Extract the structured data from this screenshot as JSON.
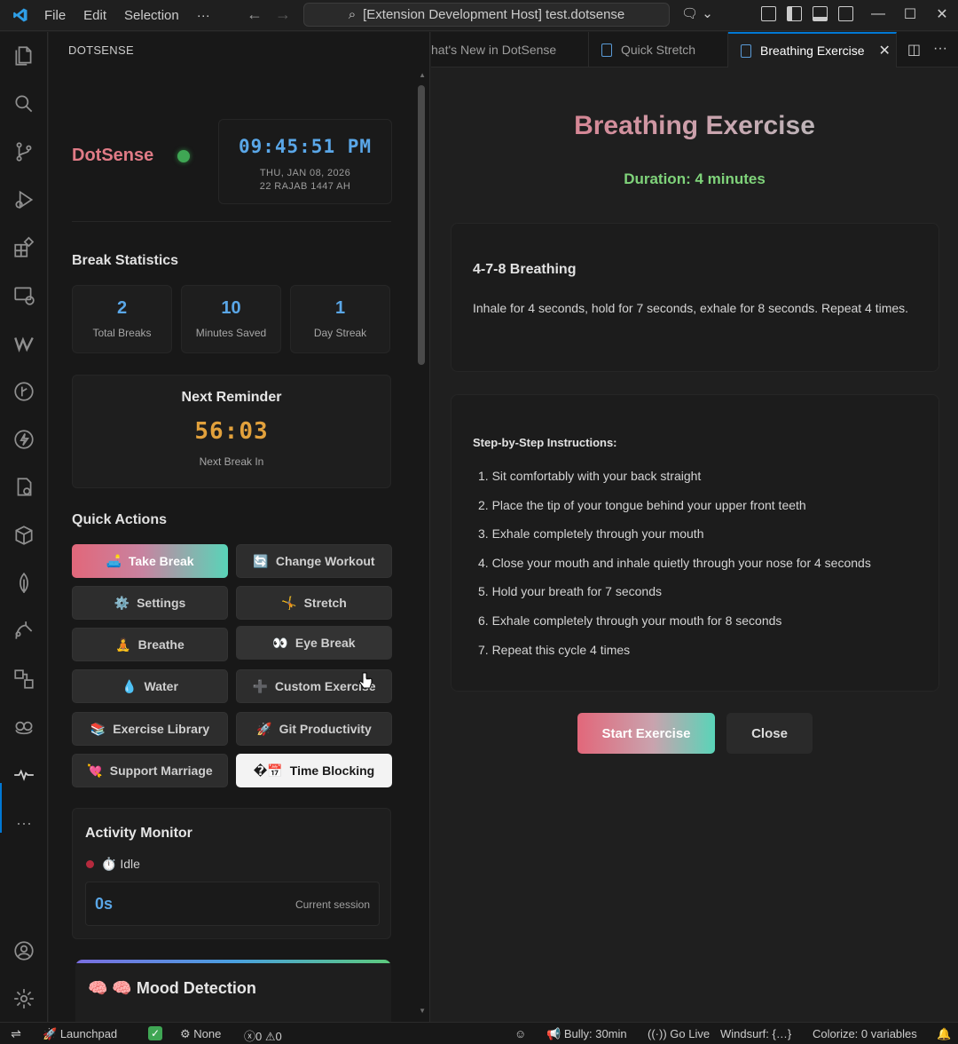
{
  "titlebar": {
    "menu": [
      "File",
      "Edit",
      "Selection",
      "···"
    ],
    "search": "[Extension Development Host] test.dotsense"
  },
  "sidebar": {
    "header": "DOTSENSE",
    "brand": "DotSense",
    "clock": {
      "time": "09:45:51 PM",
      "date": "THU, JAN 08, 2026",
      "hijri": "22 RAJAB 1447 AH"
    },
    "break_stats": {
      "title": "Break Statistics",
      "cards": [
        {
          "value": "2",
          "label": "Total Breaks"
        },
        {
          "value": "10",
          "label": "Minutes Saved"
        },
        {
          "value": "1",
          "label": "Day Streak"
        }
      ]
    },
    "reminder": {
      "title": "Next Reminder",
      "countdown": "56:03",
      "label": "Next Break In"
    },
    "quick_actions": {
      "title": "Quick Actions",
      "buttons": [
        {
          "emoji": "🛋️",
          "label": "Take Break"
        },
        {
          "emoji": "🔄",
          "label": "Change Workout"
        },
        {
          "emoji": "⚙️",
          "label": "Settings"
        },
        {
          "emoji": "🤸",
          "label": "Stretch"
        },
        {
          "emoji": "🧘",
          "label": "Breathe"
        },
        {
          "emoji": "👀",
          "label": "Eye Break"
        },
        {
          "emoji": "💧",
          "label": "Water"
        },
        {
          "emoji": "➕",
          "label": "Custom Exercise"
        },
        {
          "emoji": "📚",
          "label": "Exercise Library"
        },
        {
          "emoji": "🚀",
          "label": "Git Productivity"
        },
        {
          "emoji": "💘",
          "label": "Support Marriage"
        },
        {
          "emoji": "�📅",
          "label": "Time Blocking"
        }
      ]
    },
    "activity": {
      "title": "Activity Monitor",
      "status": "⏱️ Idle",
      "session_value": "0s",
      "session_label": "Current session"
    },
    "mood": {
      "title": "🧠 🧠 Mood Detection"
    }
  },
  "tabs": [
    {
      "label": "hat's New in DotSense"
    },
    {
      "label": "Quick Stretch"
    },
    {
      "label": "Breathing Exercise"
    }
  ],
  "editor": {
    "title": "Breathing Exercise",
    "duration": "Duration: 4 minutes",
    "technique": {
      "title": "4-7-8 Breathing",
      "description": "Inhale for 4 seconds, hold for 7 seconds, exhale for 8 seconds. Repeat 4 times."
    },
    "instructions": {
      "heading": "Step-by-Step Instructions:",
      "steps": [
        "1. Sit comfortably with your back straight",
        "2. Place the tip of your tongue behind your upper front teeth",
        "3. Exhale completely through your mouth",
        "4. Close your mouth and inhale quietly through your nose for 4 seconds",
        "5. Hold your breath for 7 seconds",
        "6. Exhale completely through your mouth for 8 seconds",
        "7. Repeat this cycle 4 times"
      ]
    },
    "start_label": "Start Exercise",
    "close_label": "Close"
  },
  "statusbar": {
    "launchpad": "Launchpad",
    "profile": "None",
    "errors": "0",
    "warnings": "0",
    "bully": "Bully: 30min",
    "golive": "Go Live",
    "windsurf": "Windsurf: {…}",
    "colorize": "Colorize: 0 variables"
  }
}
